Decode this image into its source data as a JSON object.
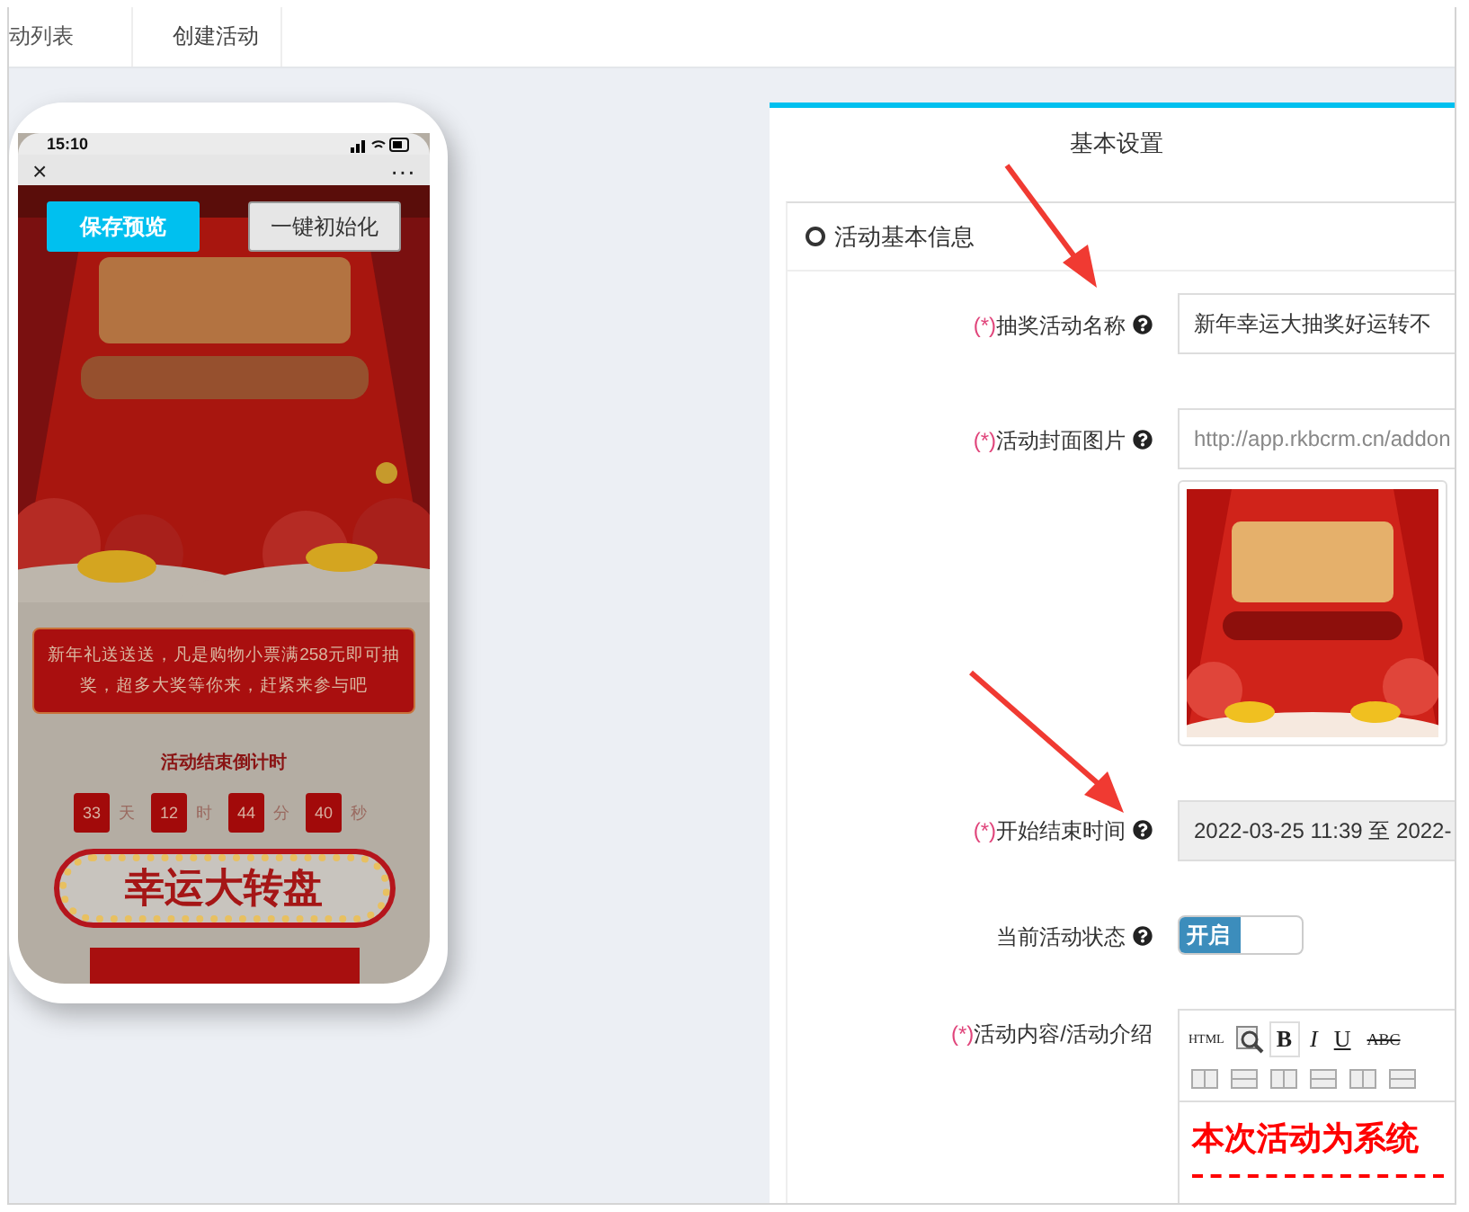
{
  "tabs": [
    {
      "label": "动列表",
      "selected": false
    },
    {
      "label": "创建活动",
      "selected": true
    }
  ],
  "phone": {
    "time": "15:10",
    "close": "×",
    "more": "···",
    "buttons": [
      {
        "label": "保存预览",
        "kind": "primary"
      },
      {
        "label": "一键初始化",
        "kind": "default"
      }
    ],
    "notice": "新年礼送送送，凡是购物小票满258元即可抽奖，超多大奖等你来，赶紧来参与吧",
    "countdown": {
      "title": "活动结束倒计时",
      "units": [
        {
          "value": "33",
          "unit": "天"
        },
        {
          "value": "12",
          "unit": "时"
        },
        {
          "value": "44",
          "unit": "分"
        },
        {
          "value": "40",
          "unit": "秒"
        }
      ]
    },
    "sign": "幸运大转盘"
  },
  "panel": {
    "title": "基本设置",
    "section": "活动基本信息",
    "fields": [
      {
        "kind": "text",
        "required_mark": "(*)",
        "label": "抽奖活动名称",
        "help": true,
        "value": "新年幸运大抽奖好运转不"
      },
      {
        "required_mark": "(*)",
        "label": "活动封面图片",
        "help": true,
        "placeholder": "http://app.rkbcrm.cn/addon"
      },
      {
        "kind": "date",
        "required_mark": "(*)",
        "label": "开始结束时间",
        "help": true,
        "value": "2022-03-25 11:39 至 2022-"
      },
      {
        "kind": "switch",
        "label": "当前活动状态",
        "help": true,
        "switch_label": "开启",
        "on": true
      },
      {
        "kind": "editor",
        "required_mark": "(*)",
        "label": "活动内容/活动介绍",
        "toolbar": [
          "HTML",
          "B",
          "I",
          "U",
          "ABC"
        ],
        "content": "本次活动为系统"
      }
    ]
  }
}
